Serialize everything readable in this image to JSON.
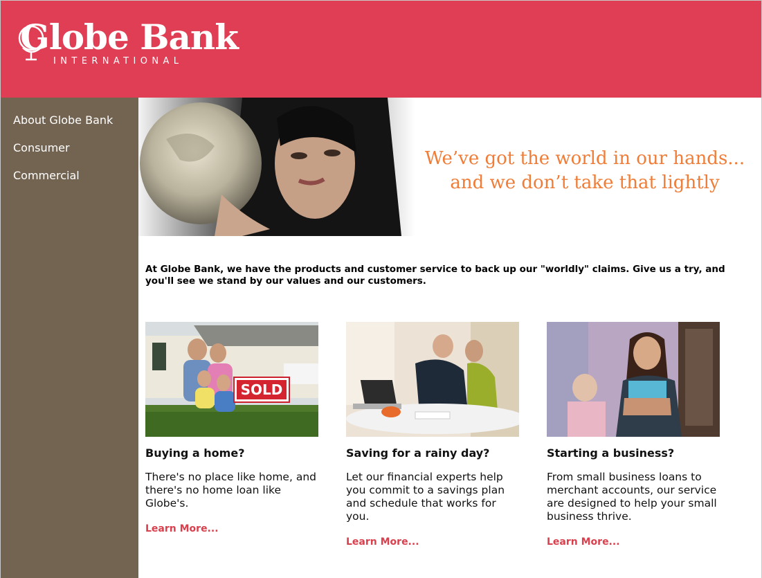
{
  "brand": {
    "name": "Globe Bank",
    "subtitle": "INTERNATIONAL",
    "primary_color": "#e03e55",
    "sidebar_color": "#736451",
    "accent_text_color": "#ef7d38",
    "link_color": "#d9404d"
  },
  "sidebar": {
    "items": [
      {
        "label": "About Globe Bank"
      },
      {
        "label": "Consumer"
      },
      {
        "label": "Commercial"
      }
    ]
  },
  "hero": {
    "image_icon": "woman-holding-globe-photo",
    "tagline_line1": "We’ve got the world in our hands...",
    "tagline_line2": "and we don’t take that lightly"
  },
  "intro": {
    "text": "At Globe Bank, we have the products and customer service to back up our \"worldly\" claims. Give us a try, and you'll see we stand by our values and our customers."
  },
  "cards": [
    {
      "image_icon": "family-sold-sign-photo",
      "title": "Buying a home?",
      "text": "There's no place like home, and there's no home loan like Globe's.",
      "link": "Learn More..."
    },
    {
      "image_icon": "couple-with-laptop-photo",
      "title": "Saving for a rainy day?",
      "text": "Let our financial experts help you commit to a savings plan and schedule that works for you.",
      "link": "Learn More..."
    },
    {
      "image_icon": "salon-owner-photo",
      "title": "Starting a business?",
      "text": "From small business loans to merchant accounts, our service are designed to help your small business thrive.",
      "link": "Learn More..."
    }
  ]
}
